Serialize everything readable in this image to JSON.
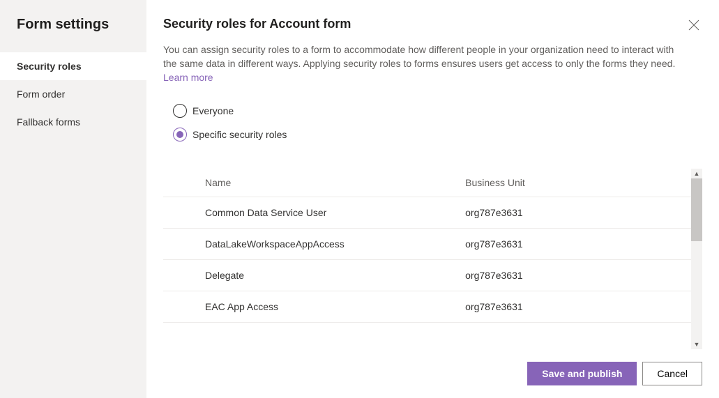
{
  "sidebar": {
    "title": "Form settings",
    "items": [
      {
        "label": "Security roles",
        "active": true
      },
      {
        "label": "Form order",
        "active": false
      },
      {
        "label": "Fallback forms",
        "active": false
      }
    ]
  },
  "main": {
    "title": "Security roles for Account form",
    "description": "You can assign security roles to a form to accommodate how different people in your organization need to interact with the same data in different ways. Applying security roles to forms ensures users get access to only the forms they need. ",
    "learn_more": "Learn more"
  },
  "radio": {
    "everyone": "Everyone",
    "specific": "Specific security roles",
    "selected": "specific"
  },
  "table": {
    "headers": {
      "name": "Name",
      "unit": "Business Unit"
    },
    "rows": [
      {
        "name": "Common Data Service User",
        "unit": "org787e3631"
      },
      {
        "name": "DataLakeWorkspaceAppAccess",
        "unit": "org787e3631"
      },
      {
        "name": "Delegate",
        "unit": "org787e3631"
      },
      {
        "name": "EAC App Access",
        "unit": "org787e3631"
      }
    ]
  },
  "footer": {
    "save": "Save and publish",
    "cancel": "Cancel"
  }
}
